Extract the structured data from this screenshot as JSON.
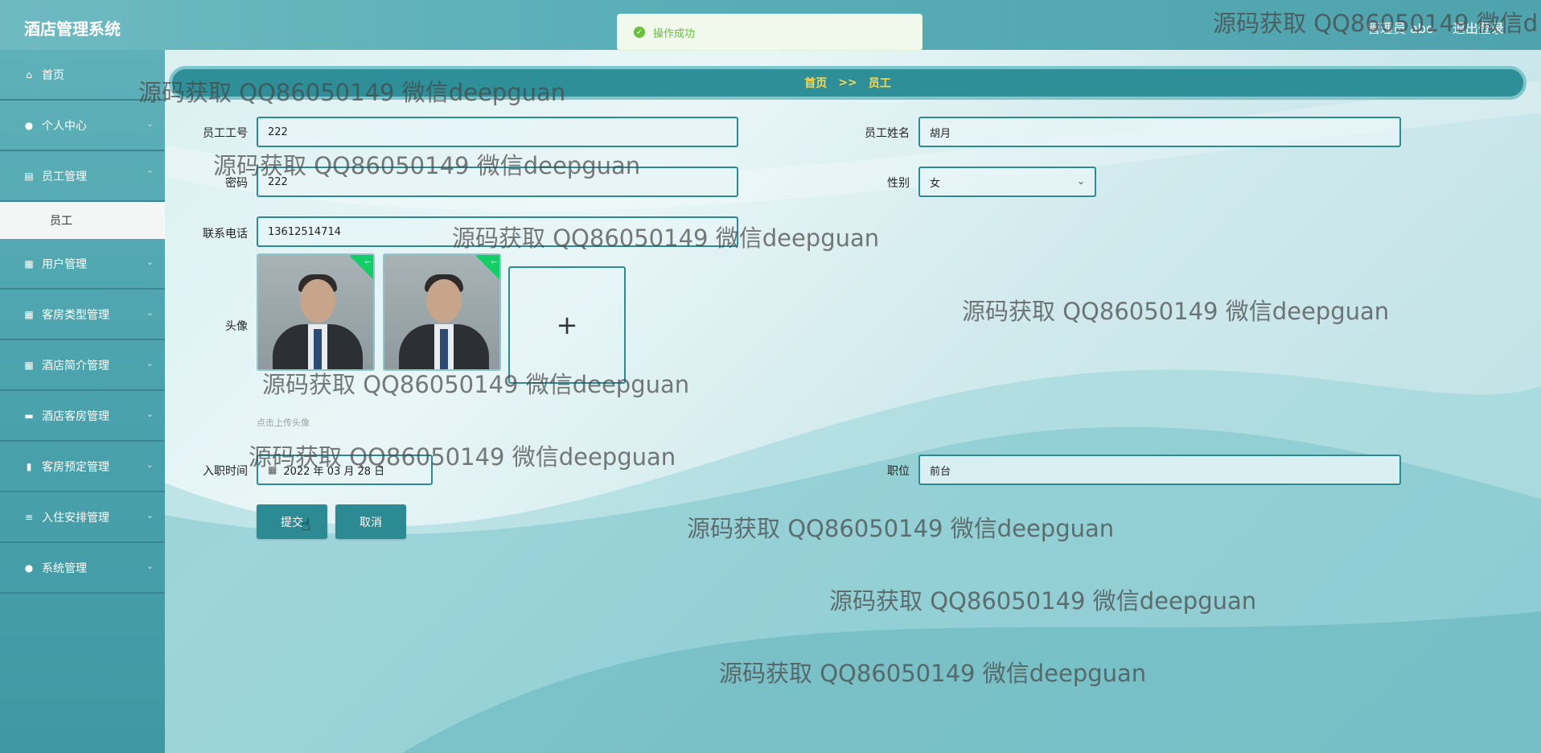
{
  "header": {
    "logo": "酒店管理系统",
    "admin_label": "管理员 abo",
    "logout_label": "退出登录"
  },
  "toast": {
    "message": "操作成功",
    "icon": "check-circle-icon"
  },
  "sidebar": {
    "items": [
      {
        "label": "首页",
        "icon": "home-icon",
        "glyph": "⌂"
      },
      {
        "label": "个人中心",
        "icon": "user-icon",
        "glyph": "●"
      },
      {
        "label": "员工管理",
        "icon": "document-icon",
        "glyph": "▤"
      },
      {
        "label": "员工",
        "submenu": true
      },
      {
        "label": "用户管理",
        "icon": "grid-icon",
        "glyph": "▦"
      },
      {
        "label": "客房类型管理",
        "icon": "grid-icon",
        "glyph": "▦"
      },
      {
        "label": "酒店简介管理",
        "icon": "grid-icon",
        "glyph": "▦"
      },
      {
        "label": "酒店客房管理",
        "icon": "message-icon",
        "glyph": "▬"
      },
      {
        "label": "客房预定管理",
        "icon": "bar-chart-icon",
        "glyph": "▮"
      },
      {
        "label": "入住安排管理",
        "icon": "sliders-icon",
        "glyph": "≡"
      },
      {
        "label": "系统管理",
        "icon": "user-icon",
        "glyph": "●"
      }
    ]
  },
  "breadcrumb": {
    "home": "首页",
    "separator": ">>",
    "current": "员工"
  },
  "form": {
    "employee_no_label": "员工工号",
    "employee_no": "222",
    "employee_name_label": "员工姓名",
    "employee_name": "胡月",
    "password_label": "密码",
    "password": "222",
    "gender_label": "性别",
    "gender": "女",
    "phone_label": "联系电话",
    "phone": "13612514714",
    "avatar_label": "头像",
    "upload_hint": "点击上传头像",
    "hire_date_label": "入职时间",
    "hire_date": "2022 年 03 月 28 日",
    "position_label": "职位",
    "position": "前台",
    "submit_label": "提交",
    "cancel_label": "取消"
  },
  "watermark": "源码获取 QQ86050149 微信deepguan",
  "watermark_cut": "源码获取 QQ86050149 微信d",
  "colors": {
    "primary": "#2c8a93",
    "accent": "#ffd84a",
    "success": "#67c23a"
  }
}
